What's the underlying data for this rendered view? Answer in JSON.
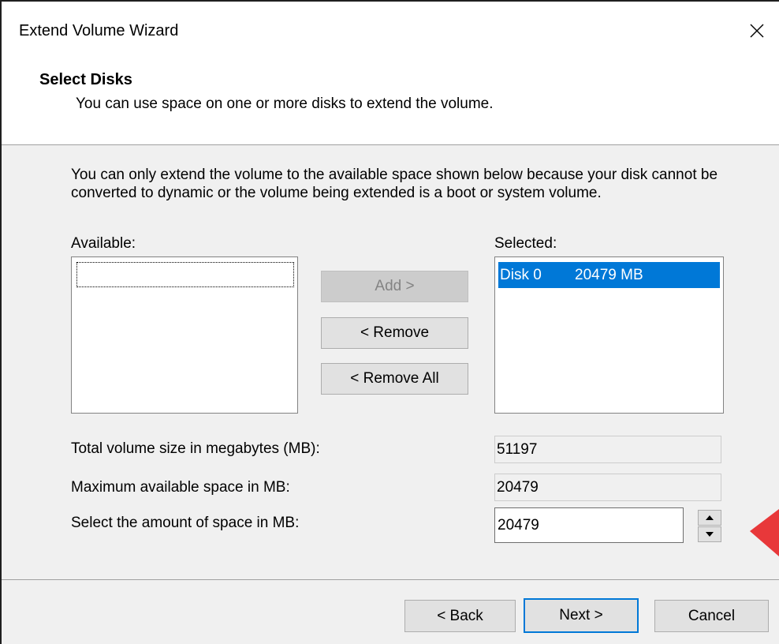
{
  "window": {
    "title": "Extend Volume Wizard"
  },
  "header": {
    "title": "Select Disks",
    "subtitle": "You can use space on one or more disks to extend the volume."
  },
  "info_text": "You can only extend the volume to the available space shown below because your disk cannot be converted to dynamic or the volume being extended is a boot or system volume.",
  "available": {
    "label": "Available:",
    "items": []
  },
  "selected": {
    "label": "Selected:",
    "items": [
      {
        "disk": "Disk 0",
        "size": "20479 MB"
      }
    ]
  },
  "buttons": {
    "add": "Add >",
    "remove": "< Remove",
    "remove_all": "< Remove All",
    "back": "< Back",
    "next": "Next >",
    "cancel": "Cancel"
  },
  "fields": {
    "total_label": "Total volume size in megabytes (MB):",
    "total_value": "51197",
    "max_label": "Maximum available space in MB:",
    "max_value": "20479",
    "select_label": "Select the amount of space in MB:",
    "select_value": "20479"
  },
  "colors": {
    "selection": "#0078d7",
    "annotation_arrow": "#e8383a"
  },
  "icons": {
    "close": "close-icon",
    "spin_up": "triangle-up-icon",
    "spin_down": "triangle-down-icon"
  }
}
